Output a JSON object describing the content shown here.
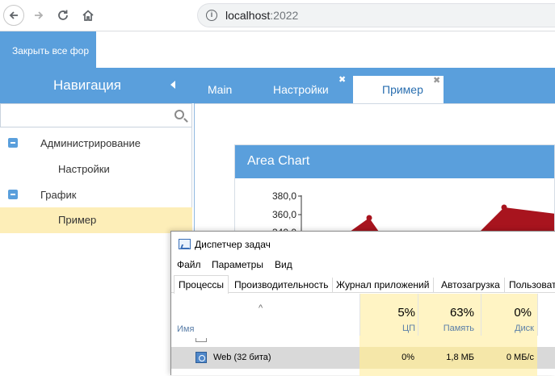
{
  "browser": {
    "url_host": "localhost",
    "url_port": ":2022"
  },
  "app": {
    "close_all_label": "Закрыть все фор",
    "nav_title": "Навигация",
    "tabs": [
      {
        "label": "Main"
      },
      {
        "label": "Настройки"
      },
      {
        "label": "Пример"
      }
    ],
    "search_placeholder": "",
    "tree": [
      {
        "label": "Администрирование"
      },
      {
        "label": "Настройки"
      },
      {
        "label": "График"
      },
      {
        "label": "Пример"
      }
    ],
    "chart_panel_title": "Area Chart"
  },
  "chart_data": {
    "type": "area",
    "title": "Area Chart",
    "yticks": [
      "380,0",
      "360,0",
      "340,0"
    ],
    "color": "#a8141e"
  },
  "task_manager": {
    "title": "Диспетчер задач",
    "menu": [
      "Файл",
      "Параметры",
      "Вид"
    ],
    "tabs": [
      "Процессы",
      "Производительность",
      "Журнал приложений",
      "Автозагрузка",
      "Пользоват"
    ],
    "name_header": "Имя",
    "columns": [
      {
        "percent": "5%",
        "name": "ЦП"
      },
      {
        "percent": "63%",
        "name": "Память"
      },
      {
        "percent": "0%",
        "name": "Диск"
      }
    ],
    "row": {
      "name": "Web (32 бита)",
      "cpu": "0%",
      "memory": "1,8 МБ",
      "disk": "0 МБ/с"
    }
  }
}
